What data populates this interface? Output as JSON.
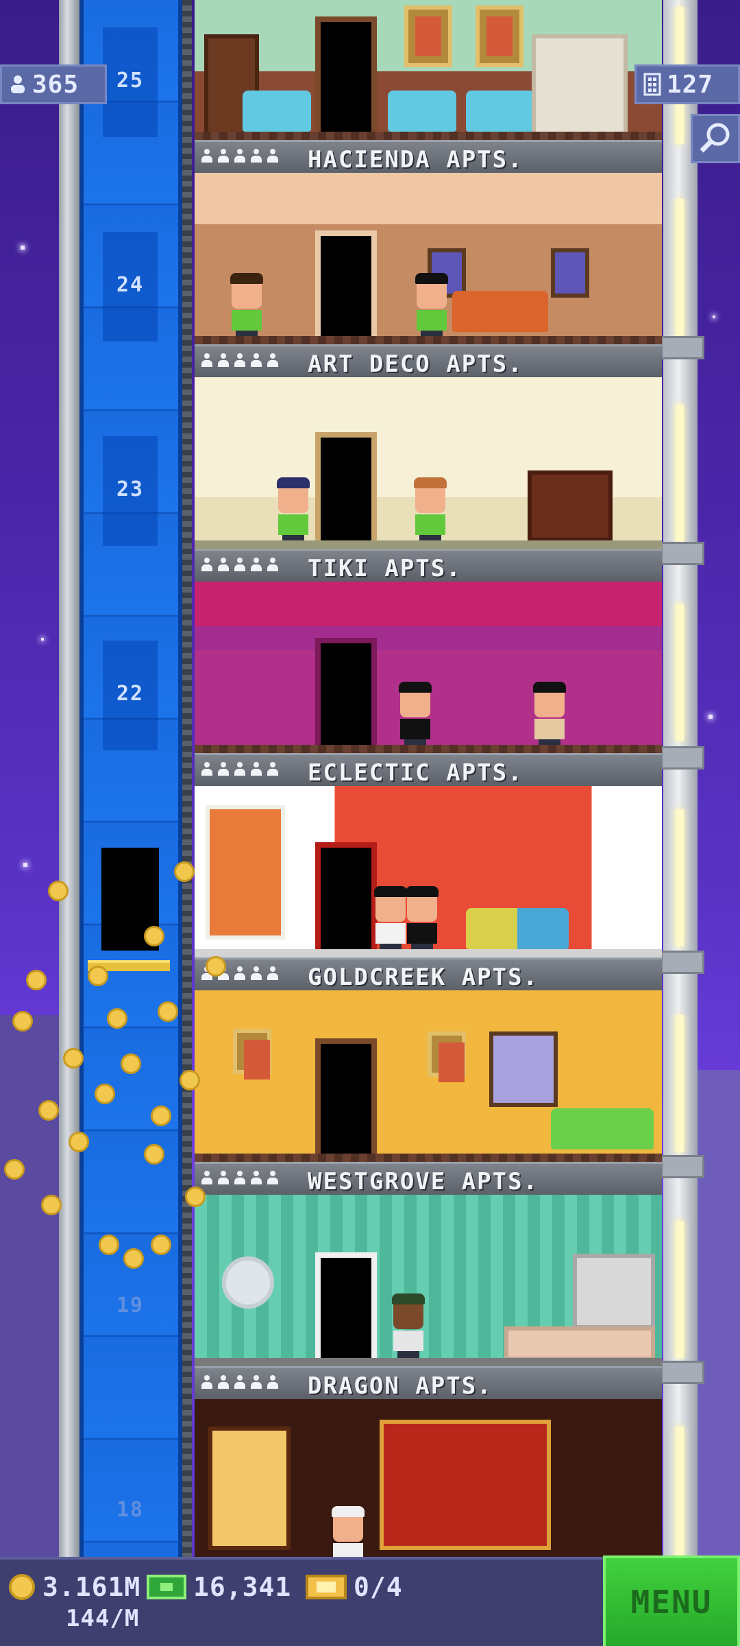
{
  "hud": {
    "population": "365",
    "floors": "127"
  },
  "shaft": {
    "floor_numbers": [
      "25",
      "24",
      "23",
      "22",
      "19",
      "18"
    ]
  },
  "floors": [
    {
      "name": "HACIENDA APTS.",
      "rating": 5
    },
    {
      "name": "ART DECO APTS.",
      "rating": 5
    },
    {
      "name": "TIKI APTS.",
      "rating": 5
    },
    {
      "name": "ECLECTIC APTS.",
      "rating": 5
    },
    {
      "name": "GOLDCREEK APTS.",
      "rating": 5
    },
    {
      "name": "WESTGROVE APTS.",
      "rating": 5
    },
    {
      "name": "DRAGON APTS.",
      "rating": 5
    }
  ],
  "bottom_bar": {
    "coins": "3.161M",
    "coin_rate": "144/M",
    "bux": "16,341",
    "tickets": "0/4",
    "menu_label": "MENU"
  },
  "icons": [
    "population-icon",
    "floors-icon",
    "search-icon",
    "coin-icon",
    "bux-icon",
    "ticket-icon"
  ],
  "colors": {
    "menu_green": "#34c033",
    "shaft_blue": "#1a6be0",
    "sky_purple": "#4b25a8"
  }
}
